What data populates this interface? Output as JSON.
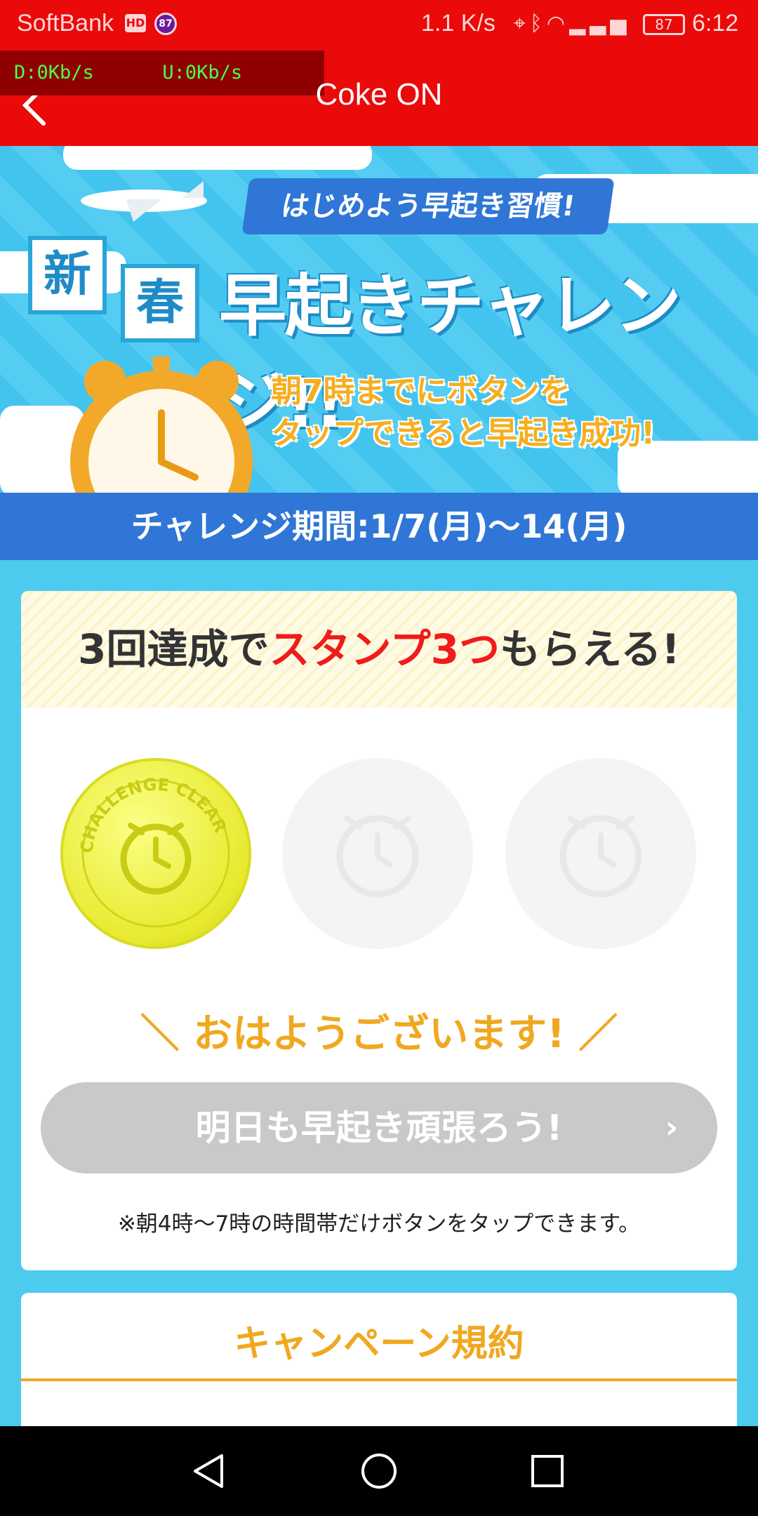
{
  "status_bar": {
    "carrier": "SoftBank",
    "hd_badge": "HD",
    "notification_count": "87",
    "net_speed": "1.1 K/s",
    "battery": "87",
    "time": "6:12"
  },
  "overlay": {
    "text": "D:0Kb/s      U:0Kb/s"
  },
  "app_bar": {
    "title": "Coke ON"
  },
  "hero": {
    "tagline": "はじめよう早起き習慣!",
    "tile_1": "新",
    "tile_2": "春",
    "headline": "早起きチャレンジ!!",
    "sub_line_1": "朝7時までにボタンを",
    "sub_line_2": "タップできると早起き成功!"
  },
  "period": {
    "text": "チャレンジ期間:1/7(月)〜14(月)"
  },
  "card": {
    "head_prefix": "3回達成で",
    "head_accent": "スタンプ3つ",
    "head_suffix": "もらえる!",
    "stamps": [
      {
        "state": "cleared",
        "ring_text": "CHALLENGE CLEAR"
      },
      {
        "state": "empty"
      },
      {
        "state": "empty"
      }
    ],
    "stamps_collected": 1,
    "stamps_total": 3,
    "greeting": "＼ おはようございます! ／",
    "cta_label": "明日も早起き頑張ろう!",
    "note": "※朝4時〜7時の時間帯だけボタンをタップできます。"
  },
  "terms": {
    "title": "キャンペーン規約"
  },
  "icons": {
    "back": "chevron-left-icon",
    "cta_chevron": "chevron-right-icon",
    "nav_back": "triangle-back-icon",
    "nav_home": "circle-home-icon",
    "nav_recent": "square-recent-icon"
  },
  "colors": {
    "brand_red": "#ea0a0a",
    "sky_blue": "#4ccbef",
    "banner_blue": "#2f76d6",
    "accent_orange": "#f0a820",
    "stamp_yellow": "#e7ea2e"
  }
}
